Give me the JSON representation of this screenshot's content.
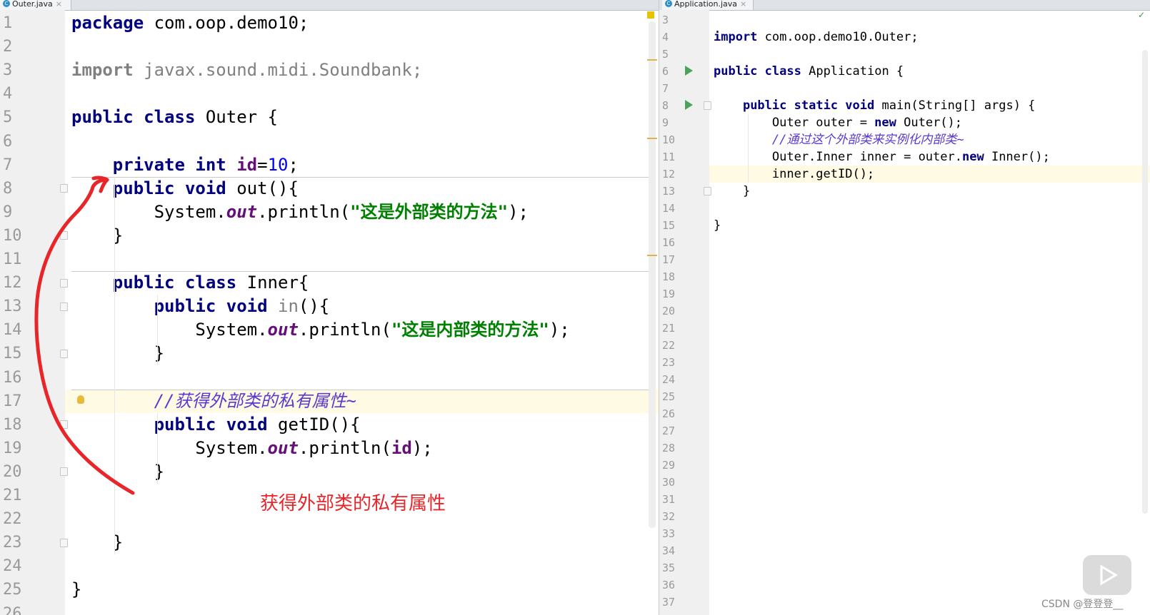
{
  "left_editor": {
    "tab_label": "Outer.java",
    "tab_icon_letter": "C",
    "line_numbers": [
      "1",
      "2",
      "3",
      "4",
      "5",
      "6",
      "7",
      "8",
      "9",
      "10",
      "11",
      "12",
      "13",
      "14",
      "15",
      "16",
      "17",
      "18",
      "19",
      "20",
      "21",
      "22",
      "23",
      "24",
      "25",
      "26"
    ],
    "lines": [
      [
        {
          "t": "package",
          "c": "kw"
        },
        {
          "t": " com.oop.demo10;"
        }
      ],
      [],
      [
        {
          "t": "import",
          "c": "kw gray"
        },
        {
          "t": " javax.sound.midi.Soundbank;",
          "c": "gray"
        }
      ],
      [],
      [
        {
          "t": "public",
          "c": "kw"
        },
        {
          "t": " "
        },
        {
          "t": "class",
          "c": "kw"
        },
        {
          "t": " Outer {"
        }
      ],
      [],
      [
        {
          "t": "    "
        },
        {
          "t": "private",
          "c": "kw"
        },
        {
          "t": " "
        },
        {
          "t": "int",
          "c": "kw"
        },
        {
          "t": " "
        },
        {
          "t": "id",
          "c": "field"
        },
        {
          "t": "="
        },
        {
          "t": "10",
          "c": "num"
        },
        {
          "t": ";"
        }
      ],
      [
        {
          "t": "    "
        },
        {
          "t": "public",
          "c": "kw"
        },
        {
          "t": " "
        },
        {
          "t": "void",
          "c": "kw"
        },
        {
          "t": " out(){"
        }
      ],
      [
        {
          "t": "        System."
        },
        {
          "t": "out",
          "c": "sfield"
        },
        {
          "t": ".println("
        },
        {
          "t": "\"这是外部类的方法\"",
          "c": "str"
        },
        {
          "t": ");"
        }
      ],
      [
        {
          "t": "    }"
        }
      ],
      [],
      [
        {
          "t": "    "
        },
        {
          "t": "public",
          "c": "kw"
        },
        {
          "t": " "
        },
        {
          "t": "class",
          "c": "kw"
        },
        {
          "t": " Inner{"
        }
      ],
      [
        {
          "t": "        "
        },
        {
          "t": "public",
          "c": "kw"
        },
        {
          "t": " "
        },
        {
          "t": "void",
          "c": "kw"
        },
        {
          "t": " "
        },
        {
          "t": "in",
          "c": "gray"
        },
        {
          "t": "(){"
        }
      ],
      [
        {
          "t": "            System."
        },
        {
          "t": "out",
          "c": "sfield"
        },
        {
          "t": ".println("
        },
        {
          "t": "\"这是内部类的方法\"",
          "c": "str"
        },
        {
          "t": ");"
        }
      ],
      [
        {
          "t": "        }"
        }
      ],
      [],
      [
        {
          "t": "        "
        },
        {
          "t": "//获得外部类的私有属性~",
          "c": "cmt"
        }
      ],
      [
        {
          "t": "        "
        },
        {
          "t": "public",
          "c": "kw"
        },
        {
          "t": " "
        },
        {
          "t": "void",
          "c": "kw"
        },
        {
          "t": " getID(){"
        }
      ],
      [
        {
          "t": "            System."
        },
        {
          "t": "out",
          "c": "sfield"
        },
        {
          "t": ".println("
        },
        {
          "t": "id",
          "c": "field"
        },
        {
          "t": ");"
        }
      ],
      [
        {
          "t": "        }"
        }
      ],
      [],
      [],
      [
        {
          "t": "    }"
        }
      ],
      [],
      [
        {
          "t": "}"
        }
      ],
      []
    ]
  },
  "right_editor": {
    "tab_label": "Application.java",
    "tab_icon_letter": "C",
    "line_numbers": [
      "3",
      "4",
      "5",
      "6",
      "7",
      "8",
      "9",
      "10",
      "11",
      "12",
      "13",
      "14",
      "15",
      "16",
      "17",
      "18",
      "19",
      "20",
      "21",
      "22",
      "23",
      "24",
      "25",
      "26",
      "27",
      "28",
      "29",
      "30",
      "31",
      "32",
      "33",
      "34",
      "35",
      "36",
      "37"
    ],
    "lines": [
      [],
      [
        {
          "t": "import",
          "c": "kw"
        },
        {
          "t": " com.oop.demo10.Outer;"
        }
      ],
      [],
      [
        {
          "t": "public",
          "c": "kw"
        },
        {
          "t": " "
        },
        {
          "t": "class",
          "c": "kw"
        },
        {
          "t": " Application {"
        }
      ],
      [],
      [
        {
          "t": "    "
        },
        {
          "t": "public",
          "c": "kw"
        },
        {
          "t": " "
        },
        {
          "t": "static",
          "c": "kw"
        },
        {
          "t": " "
        },
        {
          "t": "void",
          "c": "kw"
        },
        {
          "t": " main(String[] args) {"
        }
      ],
      [
        {
          "t": "        Outer outer = "
        },
        {
          "t": "new",
          "c": "kw"
        },
        {
          "t": " Outer();"
        }
      ],
      [
        {
          "t": "        "
        },
        {
          "t": "//通过这个外部类来实例化内部类~",
          "c": "cmt"
        }
      ],
      [
        {
          "t": "        Outer.Inner inner = outer."
        },
        {
          "t": "new",
          "c": "kw"
        },
        {
          "t": " Inner();"
        }
      ],
      [
        {
          "t": "        inner.getID();"
        }
      ],
      [
        {
          "t": "    }"
        }
      ],
      [],
      [
        {
          "t": "}"
        }
      ],
      [],
      [],
      [],
      [],
      [],
      [],
      [],
      [],
      [],
      [],
      [],
      [],
      [],
      [],
      [],
      [],
      [],
      [],
      [],
      [],
      [],
      []
    ]
  },
  "annotation": {
    "text": "获得外部类的私有属性",
    "color": "#e8262a"
  },
  "watermark": "CSDN @登登登__",
  "colors": {
    "keyword": "#000080",
    "string": "#008000",
    "number": "#0000ff",
    "field": "#660e7a",
    "comment": "#5a39d1",
    "current_line": "#fffae3",
    "gutter": "#f0f0f0"
  }
}
